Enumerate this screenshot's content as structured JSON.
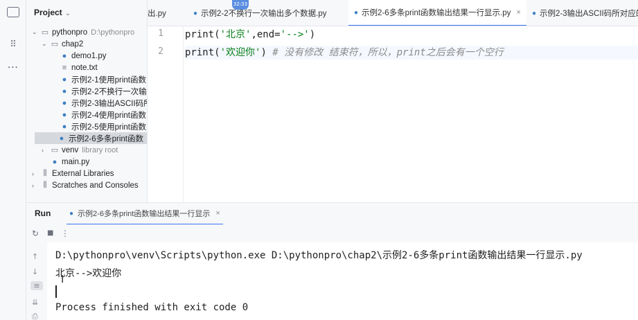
{
  "project_panel": {
    "title": "Project",
    "chevron": "⌄",
    "tree": [
      {
        "label": "pythonpro",
        "hint": "D:\\pythonpro",
        "type": "dir",
        "expanded": true
      },
      {
        "label": "chap2",
        "type": "dir",
        "expanded": true
      },
      {
        "label": "demo1.py",
        "type": "py"
      },
      {
        "label": "note.txt",
        "type": "txt"
      },
      {
        "label": "示例2-1使用print函数",
        "type": "py"
      },
      {
        "label": "示例2-2不换行一次输",
        "type": "py"
      },
      {
        "label": "示例2-3输出ASCII码所",
        "type": "py"
      },
      {
        "label": "示例2-4使用print函数",
        "type": "py"
      },
      {
        "label": "示例2-5使用print函数",
        "type": "py"
      },
      {
        "label": "示例2-6多条print函数",
        "type": "py",
        "selected": true
      },
      {
        "label": "venv",
        "hint": "library root",
        "type": "dir",
        "expanded": false
      },
      {
        "label": "main.py",
        "type": "py"
      },
      {
        "label": "External Libraries",
        "type": "lib",
        "expanded": false
      },
      {
        "label": "Scratches and Consoles",
        "type": "lib",
        "expanded": false
      }
    ]
  },
  "editor_tabs": [
    {
      "label": "出.py"
    },
    {
      "label": "示例2-2不换行一次输出多个数据.py"
    },
    {
      "label": "示例2-6多条print函数输出结果一行显示.py",
      "active": true
    },
    {
      "label": "示例2-3输出ASCII码所对应的"
    }
  ],
  "timer_badge": "32:33",
  "editor": {
    "lines": [
      {
        "number": "1",
        "tokens": [
          {
            "text": "print(",
            "cls": "kw"
          },
          {
            "text": "'北京'",
            "cls": "str"
          },
          {
            "text": ",end=",
            "cls": "kw"
          },
          {
            "text": "'-->'",
            "cls": "str"
          },
          {
            "text": ")",
            "cls": "kw"
          }
        ]
      },
      {
        "number": "2",
        "tokens": [
          {
            "text": "print(",
            "cls": "kw"
          },
          {
            "text": "'欢迎你'",
            "cls": "str"
          },
          {
            "text": ") ",
            "cls": "kw"
          },
          {
            "text": "# 没有修改 结束符，所以，print之后会有一个空行",
            "cls": "cm"
          }
        ]
      }
    ]
  },
  "run_panel": {
    "label": "Run",
    "tab_label": "示例2-6多条print函数输出结果一行显示",
    "console": {
      "command": "D:\\pythonpro\\venv\\Scripts\\python.exe D:\\pythonpro\\chap2\\示例2-6多条print函数输出结果一行显示.py",
      "output": "北京-->欢迎你",
      "exit": "Process finished with exit code 0"
    }
  },
  "icons": {
    "py": "●",
    "dir": "▭",
    "txt": "≡",
    "lib": "⫼",
    "close": "×"
  }
}
